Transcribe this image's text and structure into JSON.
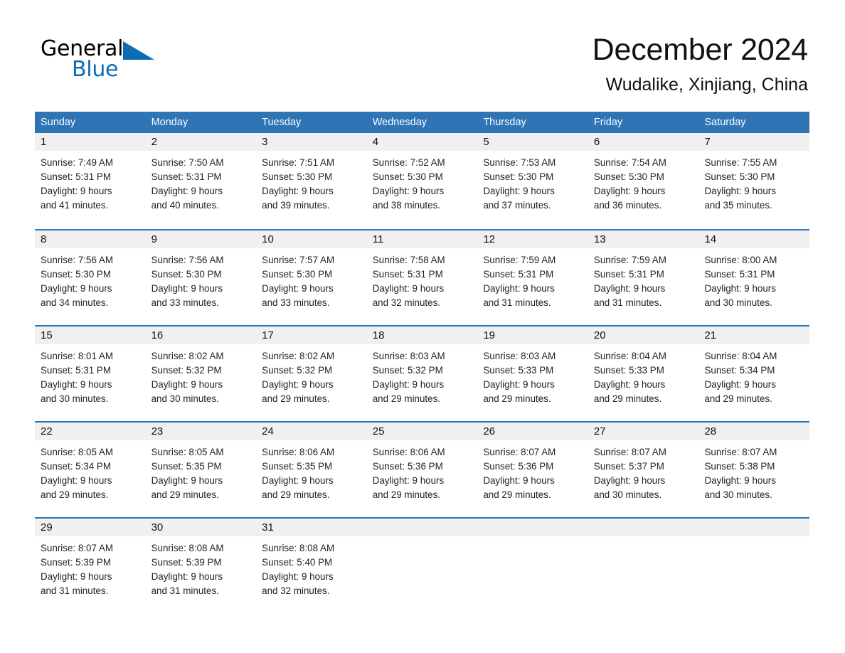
{
  "brand": {
    "name_part1": "General",
    "name_part2": "Blue",
    "triangle_icon": "triangle-icon",
    "accent_color": "#0b6cb5"
  },
  "header": {
    "month_title": "December 2024",
    "location": "Wudalike, Xinjiang, China"
  },
  "calendar": {
    "header_color": "#2f74b5",
    "daynum_strip_color": "#f0f0f0",
    "weekday_headers": [
      "Sunday",
      "Monday",
      "Tuesday",
      "Wednesday",
      "Thursday",
      "Friday",
      "Saturday"
    ],
    "weeks": [
      [
        {
          "day": "1",
          "sunrise": "Sunrise: 7:49 AM",
          "sunset": "Sunset: 5:31 PM",
          "daylight_line1": "Daylight: 9 hours",
          "daylight_line2": "and 41 minutes."
        },
        {
          "day": "2",
          "sunrise": "Sunrise: 7:50 AM",
          "sunset": "Sunset: 5:31 PM",
          "daylight_line1": "Daylight: 9 hours",
          "daylight_line2": "and 40 minutes."
        },
        {
          "day": "3",
          "sunrise": "Sunrise: 7:51 AM",
          "sunset": "Sunset: 5:30 PM",
          "daylight_line1": "Daylight: 9 hours",
          "daylight_line2": "and 39 minutes."
        },
        {
          "day": "4",
          "sunrise": "Sunrise: 7:52 AM",
          "sunset": "Sunset: 5:30 PM",
          "daylight_line1": "Daylight: 9 hours",
          "daylight_line2": "and 38 minutes."
        },
        {
          "day": "5",
          "sunrise": "Sunrise: 7:53 AM",
          "sunset": "Sunset: 5:30 PM",
          "daylight_line1": "Daylight: 9 hours",
          "daylight_line2": "and 37 minutes."
        },
        {
          "day": "6",
          "sunrise": "Sunrise: 7:54 AM",
          "sunset": "Sunset: 5:30 PM",
          "daylight_line1": "Daylight: 9 hours",
          "daylight_line2": "and 36 minutes."
        },
        {
          "day": "7",
          "sunrise": "Sunrise: 7:55 AM",
          "sunset": "Sunset: 5:30 PM",
          "daylight_line1": "Daylight: 9 hours",
          "daylight_line2": "and 35 minutes."
        }
      ],
      [
        {
          "day": "8",
          "sunrise": "Sunrise: 7:56 AM",
          "sunset": "Sunset: 5:30 PM",
          "daylight_line1": "Daylight: 9 hours",
          "daylight_line2": "and 34 minutes."
        },
        {
          "day": "9",
          "sunrise": "Sunrise: 7:56 AM",
          "sunset": "Sunset: 5:30 PM",
          "daylight_line1": "Daylight: 9 hours",
          "daylight_line2": "and 33 minutes."
        },
        {
          "day": "10",
          "sunrise": "Sunrise: 7:57 AM",
          "sunset": "Sunset: 5:30 PM",
          "daylight_line1": "Daylight: 9 hours",
          "daylight_line2": "and 33 minutes."
        },
        {
          "day": "11",
          "sunrise": "Sunrise: 7:58 AM",
          "sunset": "Sunset: 5:31 PM",
          "daylight_line1": "Daylight: 9 hours",
          "daylight_line2": "and 32 minutes."
        },
        {
          "day": "12",
          "sunrise": "Sunrise: 7:59 AM",
          "sunset": "Sunset: 5:31 PM",
          "daylight_line1": "Daylight: 9 hours",
          "daylight_line2": "and 31 minutes."
        },
        {
          "day": "13",
          "sunrise": "Sunrise: 7:59 AM",
          "sunset": "Sunset: 5:31 PM",
          "daylight_line1": "Daylight: 9 hours",
          "daylight_line2": "and 31 minutes."
        },
        {
          "day": "14",
          "sunrise": "Sunrise: 8:00 AM",
          "sunset": "Sunset: 5:31 PM",
          "daylight_line1": "Daylight: 9 hours",
          "daylight_line2": "and 30 minutes."
        }
      ],
      [
        {
          "day": "15",
          "sunrise": "Sunrise: 8:01 AM",
          "sunset": "Sunset: 5:31 PM",
          "daylight_line1": "Daylight: 9 hours",
          "daylight_line2": "and 30 minutes."
        },
        {
          "day": "16",
          "sunrise": "Sunrise: 8:02 AM",
          "sunset": "Sunset: 5:32 PM",
          "daylight_line1": "Daylight: 9 hours",
          "daylight_line2": "and 30 minutes."
        },
        {
          "day": "17",
          "sunrise": "Sunrise: 8:02 AM",
          "sunset": "Sunset: 5:32 PM",
          "daylight_line1": "Daylight: 9 hours",
          "daylight_line2": "and 29 minutes."
        },
        {
          "day": "18",
          "sunrise": "Sunrise: 8:03 AM",
          "sunset": "Sunset: 5:32 PM",
          "daylight_line1": "Daylight: 9 hours",
          "daylight_line2": "and 29 minutes."
        },
        {
          "day": "19",
          "sunrise": "Sunrise: 8:03 AM",
          "sunset": "Sunset: 5:33 PM",
          "daylight_line1": "Daylight: 9 hours",
          "daylight_line2": "and 29 minutes."
        },
        {
          "day": "20",
          "sunrise": "Sunrise: 8:04 AM",
          "sunset": "Sunset: 5:33 PM",
          "daylight_line1": "Daylight: 9 hours",
          "daylight_line2": "and 29 minutes."
        },
        {
          "day": "21",
          "sunrise": "Sunrise: 8:04 AM",
          "sunset": "Sunset: 5:34 PM",
          "daylight_line1": "Daylight: 9 hours",
          "daylight_line2": "and 29 minutes."
        }
      ],
      [
        {
          "day": "22",
          "sunrise": "Sunrise: 8:05 AM",
          "sunset": "Sunset: 5:34 PM",
          "daylight_line1": "Daylight: 9 hours",
          "daylight_line2": "and 29 minutes."
        },
        {
          "day": "23",
          "sunrise": "Sunrise: 8:05 AM",
          "sunset": "Sunset: 5:35 PM",
          "daylight_line1": "Daylight: 9 hours",
          "daylight_line2": "and 29 minutes."
        },
        {
          "day": "24",
          "sunrise": "Sunrise: 8:06 AM",
          "sunset": "Sunset: 5:35 PM",
          "daylight_line1": "Daylight: 9 hours",
          "daylight_line2": "and 29 minutes."
        },
        {
          "day": "25",
          "sunrise": "Sunrise: 8:06 AM",
          "sunset": "Sunset: 5:36 PM",
          "daylight_line1": "Daylight: 9 hours",
          "daylight_line2": "and 29 minutes."
        },
        {
          "day": "26",
          "sunrise": "Sunrise: 8:07 AM",
          "sunset": "Sunset: 5:36 PM",
          "daylight_line1": "Daylight: 9 hours",
          "daylight_line2": "and 29 minutes."
        },
        {
          "day": "27",
          "sunrise": "Sunrise: 8:07 AM",
          "sunset": "Sunset: 5:37 PM",
          "daylight_line1": "Daylight: 9 hours",
          "daylight_line2": "and 30 minutes."
        },
        {
          "day": "28",
          "sunrise": "Sunrise: 8:07 AM",
          "sunset": "Sunset: 5:38 PM",
          "daylight_line1": "Daylight: 9 hours",
          "daylight_line2": "and 30 minutes."
        }
      ],
      [
        {
          "day": "29",
          "sunrise": "Sunrise: 8:07 AM",
          "sunset": "Sunset: 5:39 PM",
          "daylight_line1": "Daylight: 9 hours",
          "daylight_line2": "and 31 minutes."
        },
        {
          "day": "30",
          "sunrise": "Sunrise: 8:08 AM",
          "sunset": "Sunset: 5:39 PM",
          "daylight_line1": "Daylight: 9 hours",
          "daylight_line2": "and 31 minutes."
        },
        {
          "day": "31",
          "sunrise": "Sunrise: 8:08 AM",
          "sunset": "Sunset: 5:40 PM",
          "daylight_line1": "Daylight: 9 hours",
          "daylight_line2": "and 32 minutes."
        },
        {
          "day": "",
          "sunrise": "",
          "sunset": "",
          "daylight_line1": "",
          "daylight_line2": ""
        },
        {
          "day": "",
          "sunrise": "",
          "sunset": "",
          "daylight_line1": "",
          "daylight_line2": ""
        },
        {
          "day": "",
          "sunrise": "",
          "sunset": "",
          "daylight_line1": "",
          "daylight_line2": ""
        },
        {
          "day": "",
          "sunrise": "",
          "sunset": "",
          "daylight_line1": "",
          "daylight_line2": ""
        }
      ]
    ]
  }
}
